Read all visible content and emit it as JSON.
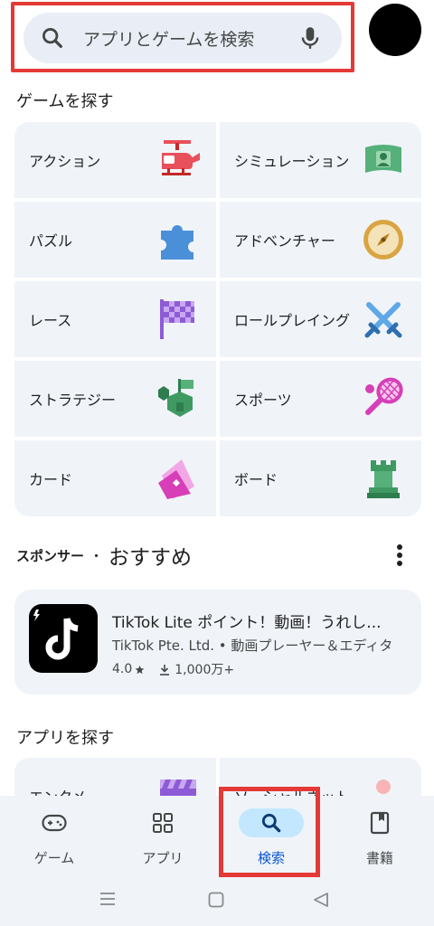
{
  "search": {
    "placeholder": "アプリとゲームを検索"
  },
  "games_section": {
    "title": "ゲームを探す",
    "categories": [
      {
        "label": "アクション",
        "icon": "helicopter-icon"
      },
      {
        "label": "シミュレーション",
        "icon": "simulation-icon"
      },
      {
        "label": "パズル",
        "icon": "puzzle-icon"
      },
      {
        "label": "アドベンチャー",
        "icon": "compass-icon"
      },
      {
        "label": "レース",
        "icon": "checkered-flag-icon"
      },
      {
        "label": "ロールプレイング",
        "icon": "crossed-swords-icon"
      },
      {
        "label": "ストラテジー",
        "icon": "strategy-icon"
      },
      {
        "label": "スポーツ",
        "icon": "tennis-icon"
      },
      {
        "label": "カード",
        "icon": "cards-icon"
      },
      {
        "label": "ボード",
        "icon": "chess-rook-icon"
      }
    ]
  },
  "sponsored": {
    "prefix": "スポンサー",
    "separator": "・",
    "title": "おすすめ",
    "app": {
      "name": "TikTok Lite ポイント！動画！うれし...",
      "developer": "TikTok Pte. Ltd. • 動画プレーヤー＆エディタ",
      "rating": "4.0",
      "downloads": "1,000万+"
    }
  },
  "apps_section": {
    "title": "アプリを探す",
    "categories": [
      {
        "label": "エンタメ",
        "icon": "clapperboard-icon"
      },
      {
        "label": "ソーシャルネット",
        "icon": "social-icon"
      }
    ]
  },
  "bottom_nav": {
    "items": [
      {
        "label": "ゲーム",
        "icon": "gamepad-icon",
        "active": false
      },
      {
        "label": "アプリ",
        "icon": "apps-grid-icon",
        "active": false
      },
      {
        "label": "検索",
        "icon": "search-icon",
        "active": true
      },
      {
        "label": "書籍",
        "icon": "book-icon",
        "active": false
      }
    ]
  },
  "colors": {
    "accent": "#0b57d0",
    "tile_bg": "#f0f4f9",
    "highlight_frame": "#e53935",
    "active_pill": "#c2e7ff"
  }
}
